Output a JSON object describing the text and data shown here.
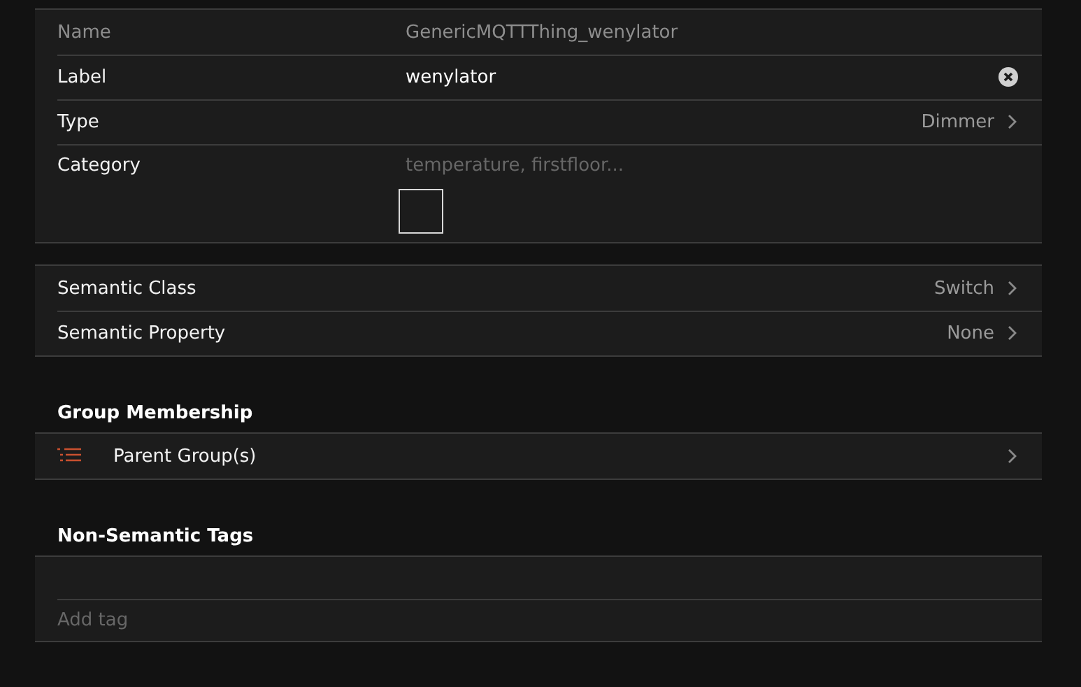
{
  "fields": [
    {
      "kind": "text",
      "label": "Name",
      "value": "GenericMQTTThing_wenylator",
      "disabled": true
    },
    {
      "kind": "text",
      "label": "Label",
      "value": "wenylator",
      "clearable": true
    },
    {
      "kind": "link",
      "label": "Type",
      "value": "Dimmer"
    },
    {
      "kind": "category",
      "label": "Category",
      "placeholder": "temperature, firstfloor..."
    }
  ],
  "semantics": [
    {
      "kind": "link",
      "label": "Semantic Class",
      "value": "Switch"
    },
    {
      "kind": "link",
      "label": "Semantic Property",
      "value": "None"
    }
  ],
  "group_membership": {
    "title": "Group Membership",
    "items": [
      {
        "kind": "group",
        "label": "Parent Group(s)"
      }
    ]
  },
  "non_semantic_tags": {
    "title": "Non-Semantic Tags",
    "placeholder": "Add tag"
  }
}
